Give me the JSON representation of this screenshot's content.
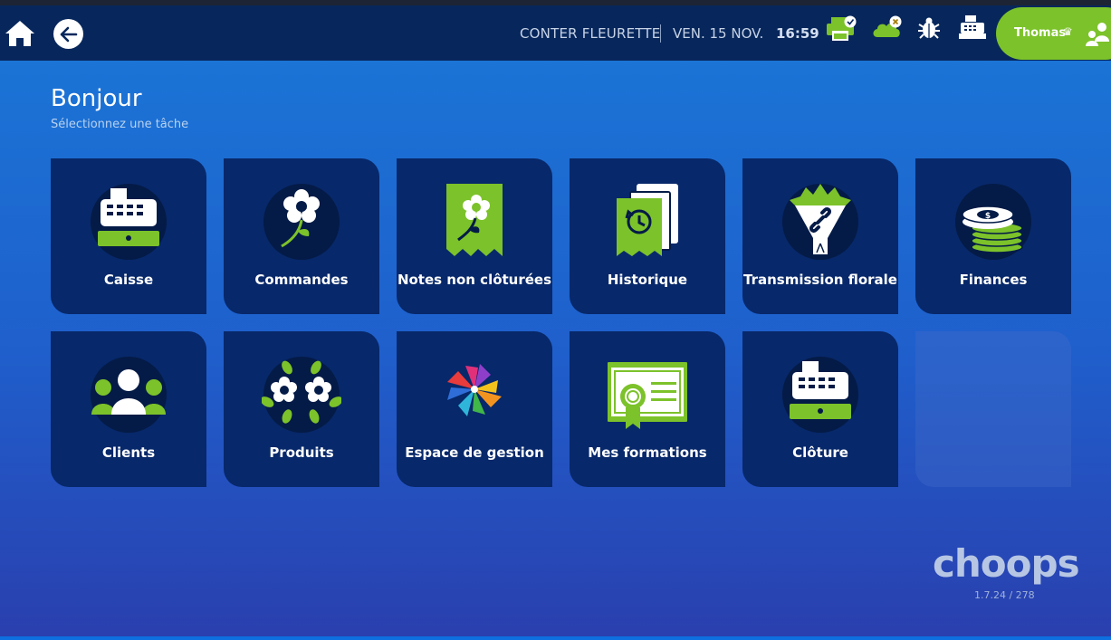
{
  "header": {
    "shop_name": "CONTER FLEURETTE",
    "date": "VEN. 15 NOV.",
    "time": "16:59",
    "user": "Thomas",
    "icons": [
      "home-icon",
      "back-arrow-icon",
      "printer-check-icon",
      "cloud-x-icon",
      "bug-icon",
      "cash-register-icon",
      "users-swap-icon"
    ],
    "colors": {
      "bar": "#07275c",
      "accent_green": "#7cc22a"
    }
  },
  "greeting": {
    "title": "Bonjour",
    "subtitle": "Sélectionnez une tâche"
  },
  "tiles": [
    {
      "label": "Caisse",
      "icon": "cash-register-icon"
    },
    {
      "label": "Commandes",
      "icon": "flower-icon"
    },
    {
      "label": "Notes non clôturées",
      "icon": "flower-note-icon"
    },
    {
      "label": "Historique",
      "icon": "history-icon"
    },
    {
      "label": "Transmission florale",
      "icon": "bouquet-link-icon"
    },
    {
      "label": "Finances",
      "icon": "coins-icon"
    },
    {
      "label": "Clients",
      "icon": "clients-icon"
    },
    {
      "label": "Produits",
      "icon": "flowers-icon"
    },
    {
      "label": "Espace de gestion",
      "icon": "pinwheel-icon"
    },
    {
      "label": "Mes formations",
      "icon": "certificate-icon"
    },
    {
      "label": "Clôture",
      "icon": "cash-register-icon"
    }
  ],
  "footer": {
    "logo": "choops",
    "version": "1.7.24 / 278"
  }
}
